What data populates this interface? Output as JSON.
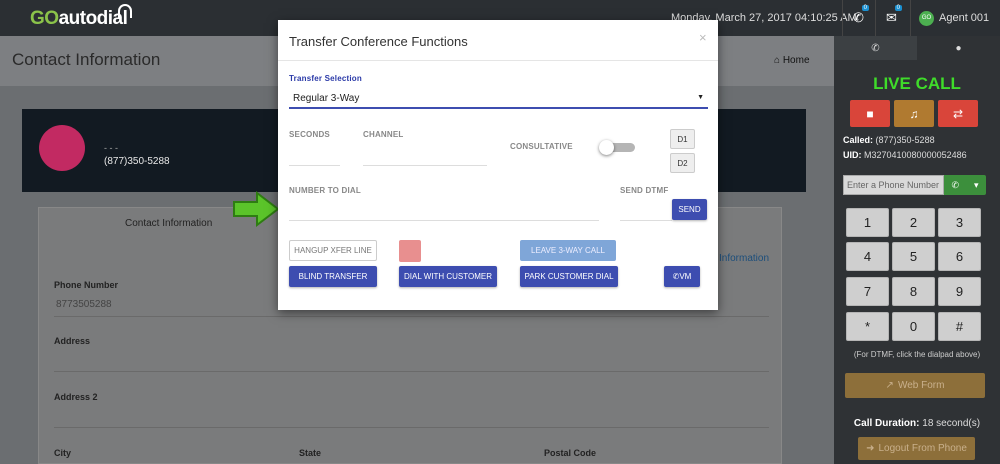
{
  "topbar": {
    "logo_go": "GO",
    "logo_rest": "autodial",
    "datetime": "Monday, March 27, 2017 04:10:25 AM",
    "phone_badge": "0",
    "mail_badge": "0",
    "agent_initials": "GO",
    "agent_name": "Agent 001"
  },
  "page": {
    "title": "Contact Information",
    "home_link": "Home",
    "card_dashes": "- - -",
    "card_phone": "(877)350-5288",
    "tab_label": "Contact Information",
    "side_link": "Information"
  },
  "form": {
    "phone_label": "Phone Number",
    "phone_value": "8773505288",
    "address_label": "Address",
    "address2_label": "Address 2",
    "city_label": "City",
    "state_label": "State",
    "postal_label": "Postal Code"
  },
  "sidebar": {
    "live_call": "LIVE CALL",
    "called_label": "Called:",
    "called_value": "(877)350-5288",
    "uid_label": "UID:",
    "uid_value": "M3270410080000052486",
    "phone_placeholder": "Enter a Phone Number",
    "keys": [
      "1",
      "2",
      "3",
      "4",
      "5",
      "6",
      "7",
      "8",
      "9",
      "*",
      "0",
      "#"
    ],
    "dtmf_note": "(For DTMF, click the dialpad above)",
    "web_form": "Web Form",
    "duration_label": "Call Duration:",
    "duration_value": "18 second(s)",
    "logout": "Logout From Phone",
    "colors": {
      "stop": "#d9453a",
      "music": "#b07a30",
      "shuffle": "#d9453a",
      "live": "#3fdc2a"
    }
  },
  "modal": {
    "title": "Transfer Conference Functions",
    "close": "×",
    "transfer_selection_label": "Transfer Selection",
    "transfer_selection_value": "Regular 3-Way",
    "seconds_label": "SECONDS",
    "channel_label": "CHANNEL",
    "consultative_label": "CONSULTATIVE",
    "d1": "D1",
    "d2": "D2",
    "number_to_dial_label": "NUMBER TO DIAL",
    "send_dtmf_label": "SEND DTMF",
    "send": "SEND",
    "hangup_xfer": "HANGUP XFER LINE",
    "leave_3way": "LEAVE 3-WAY CALL",
    "blind_transfer": "BLIND TRANSFER",
    "dial_with_customer": "DIAL WITH CUSTOMER",
    "park_customer_dial": "PARK CUSTOMER DIAL",
    "vm": "VM"
  }
}
